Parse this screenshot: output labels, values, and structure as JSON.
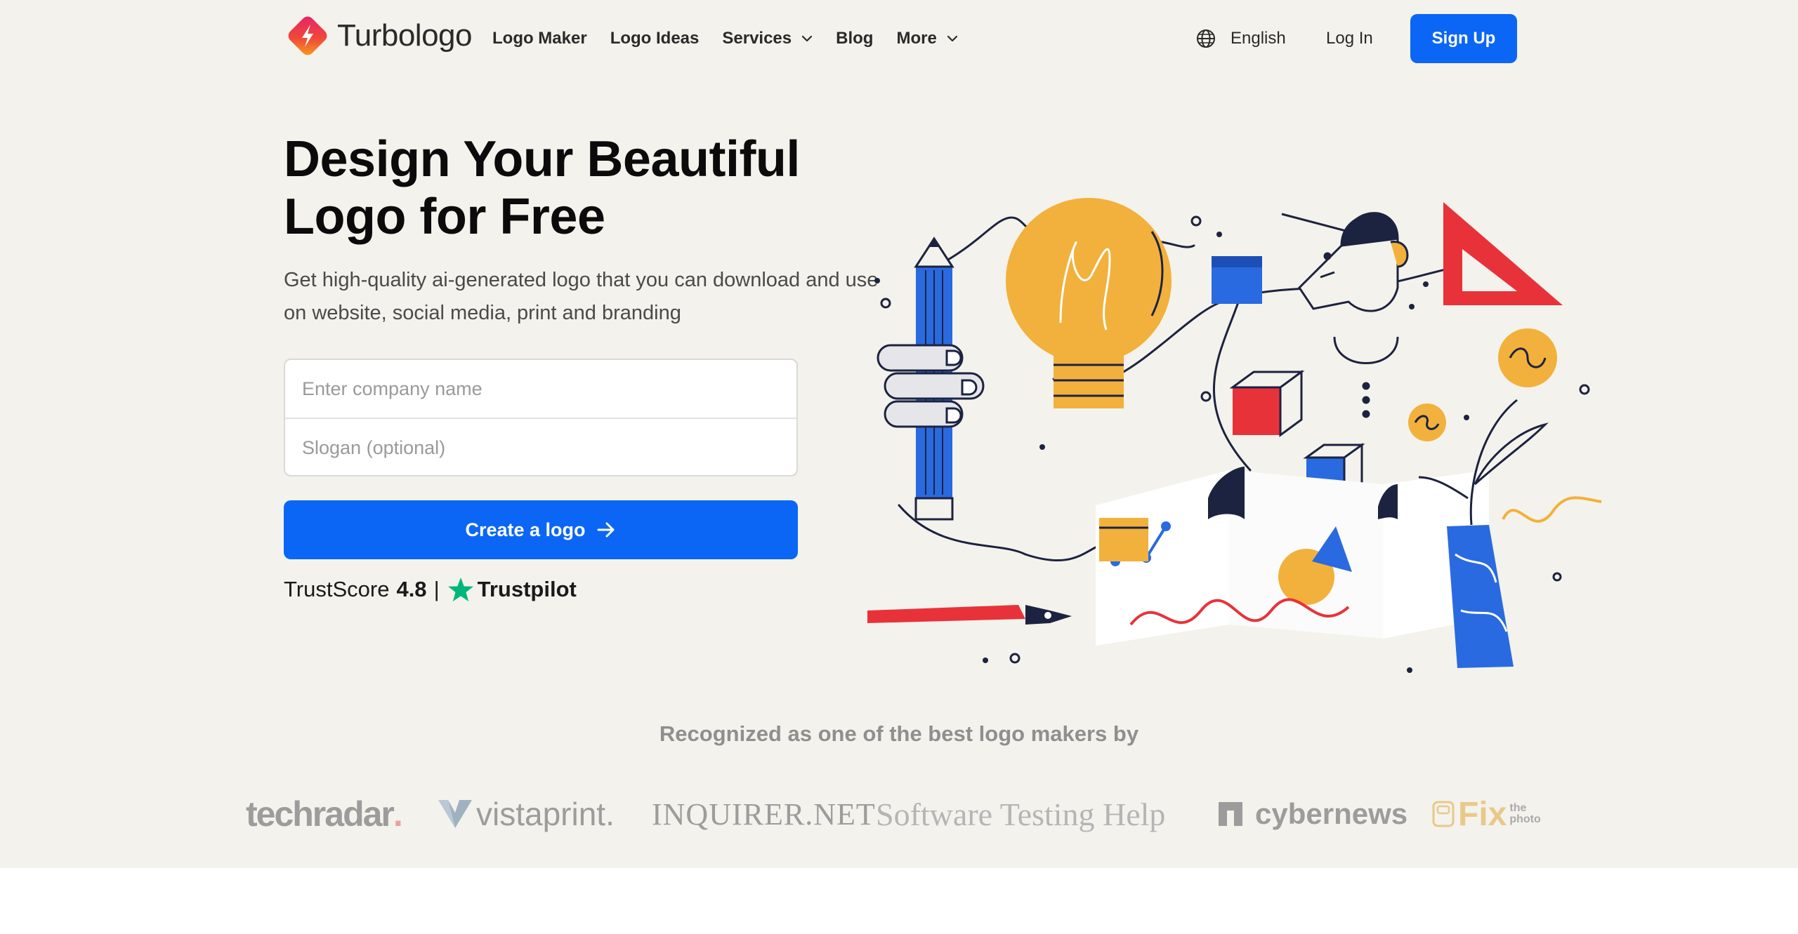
{
  "nav": {
    "brand": "Turbologo",
    "links": [
      {
        "label": "Logo Maker",
        "dropdown": false
      },
      {
        "label": "Logo Ideas",
        "dropdown": false
      },
      {
        "label": "Services",
        "dropdown": true
      },
      {
        "label": "Blog",
        "dropdown": false
      },
      {
        "label": "More",
        "dropdown": true
      }
    ],
    "language": "English",
    "login": "Log In",
    "signup": "Sign Up"
  },
  "hero": {
    "headline_line1": "Design Your Beautiful",
    "headline_line2": "Logo for Free",
    "subheadline": "Get high-quality ai-generated logo that you can download and use on website, social media, print and branding",
    "company_placeholder": "Enter company name",
    "company_value": "",
    "slogan_placeholder": "Slogan (optional)",
    "slogan_value": "",
    "cta_label": "Create a logo",
    "trust_label": "TrustScore",
    "trust_score": "4.8",
    "trust_separator": "|",
    "trust_brand": "Trustpilot"
  },
  "recognized": {
    "heading": "Recognized as one of the best logo makers by",
    "techradar": "techradar",
    "techradar_dot": ".",
    "vistaprint": "vistaprint.",
    "inquirer": "INQUIRER.NET",
    "sth": "Software Testing Help",
    "cybernews": "cybernews",
    "fix_main": "Fix",
    "fix_small": "the photo"
  },
  "colors": {
    "accent": "#0b66f5",
    "background": "#f4f2ec",
    "trustpilot_green": "#00b67a",
    "illustration_yellow": "#f2b13c",
    "illustration_red": "#e8323a",
    "illustration_blue": "#2a6ae0",
    "illustration_navy": "#1c2340"
  },
  "icons": [
    "turbologo-logo-icon",
    "chevron-down-icon",
    "globe-icon",
    "arrow-right-icon",
    "trustpilot-star-icon"
  ]
}
